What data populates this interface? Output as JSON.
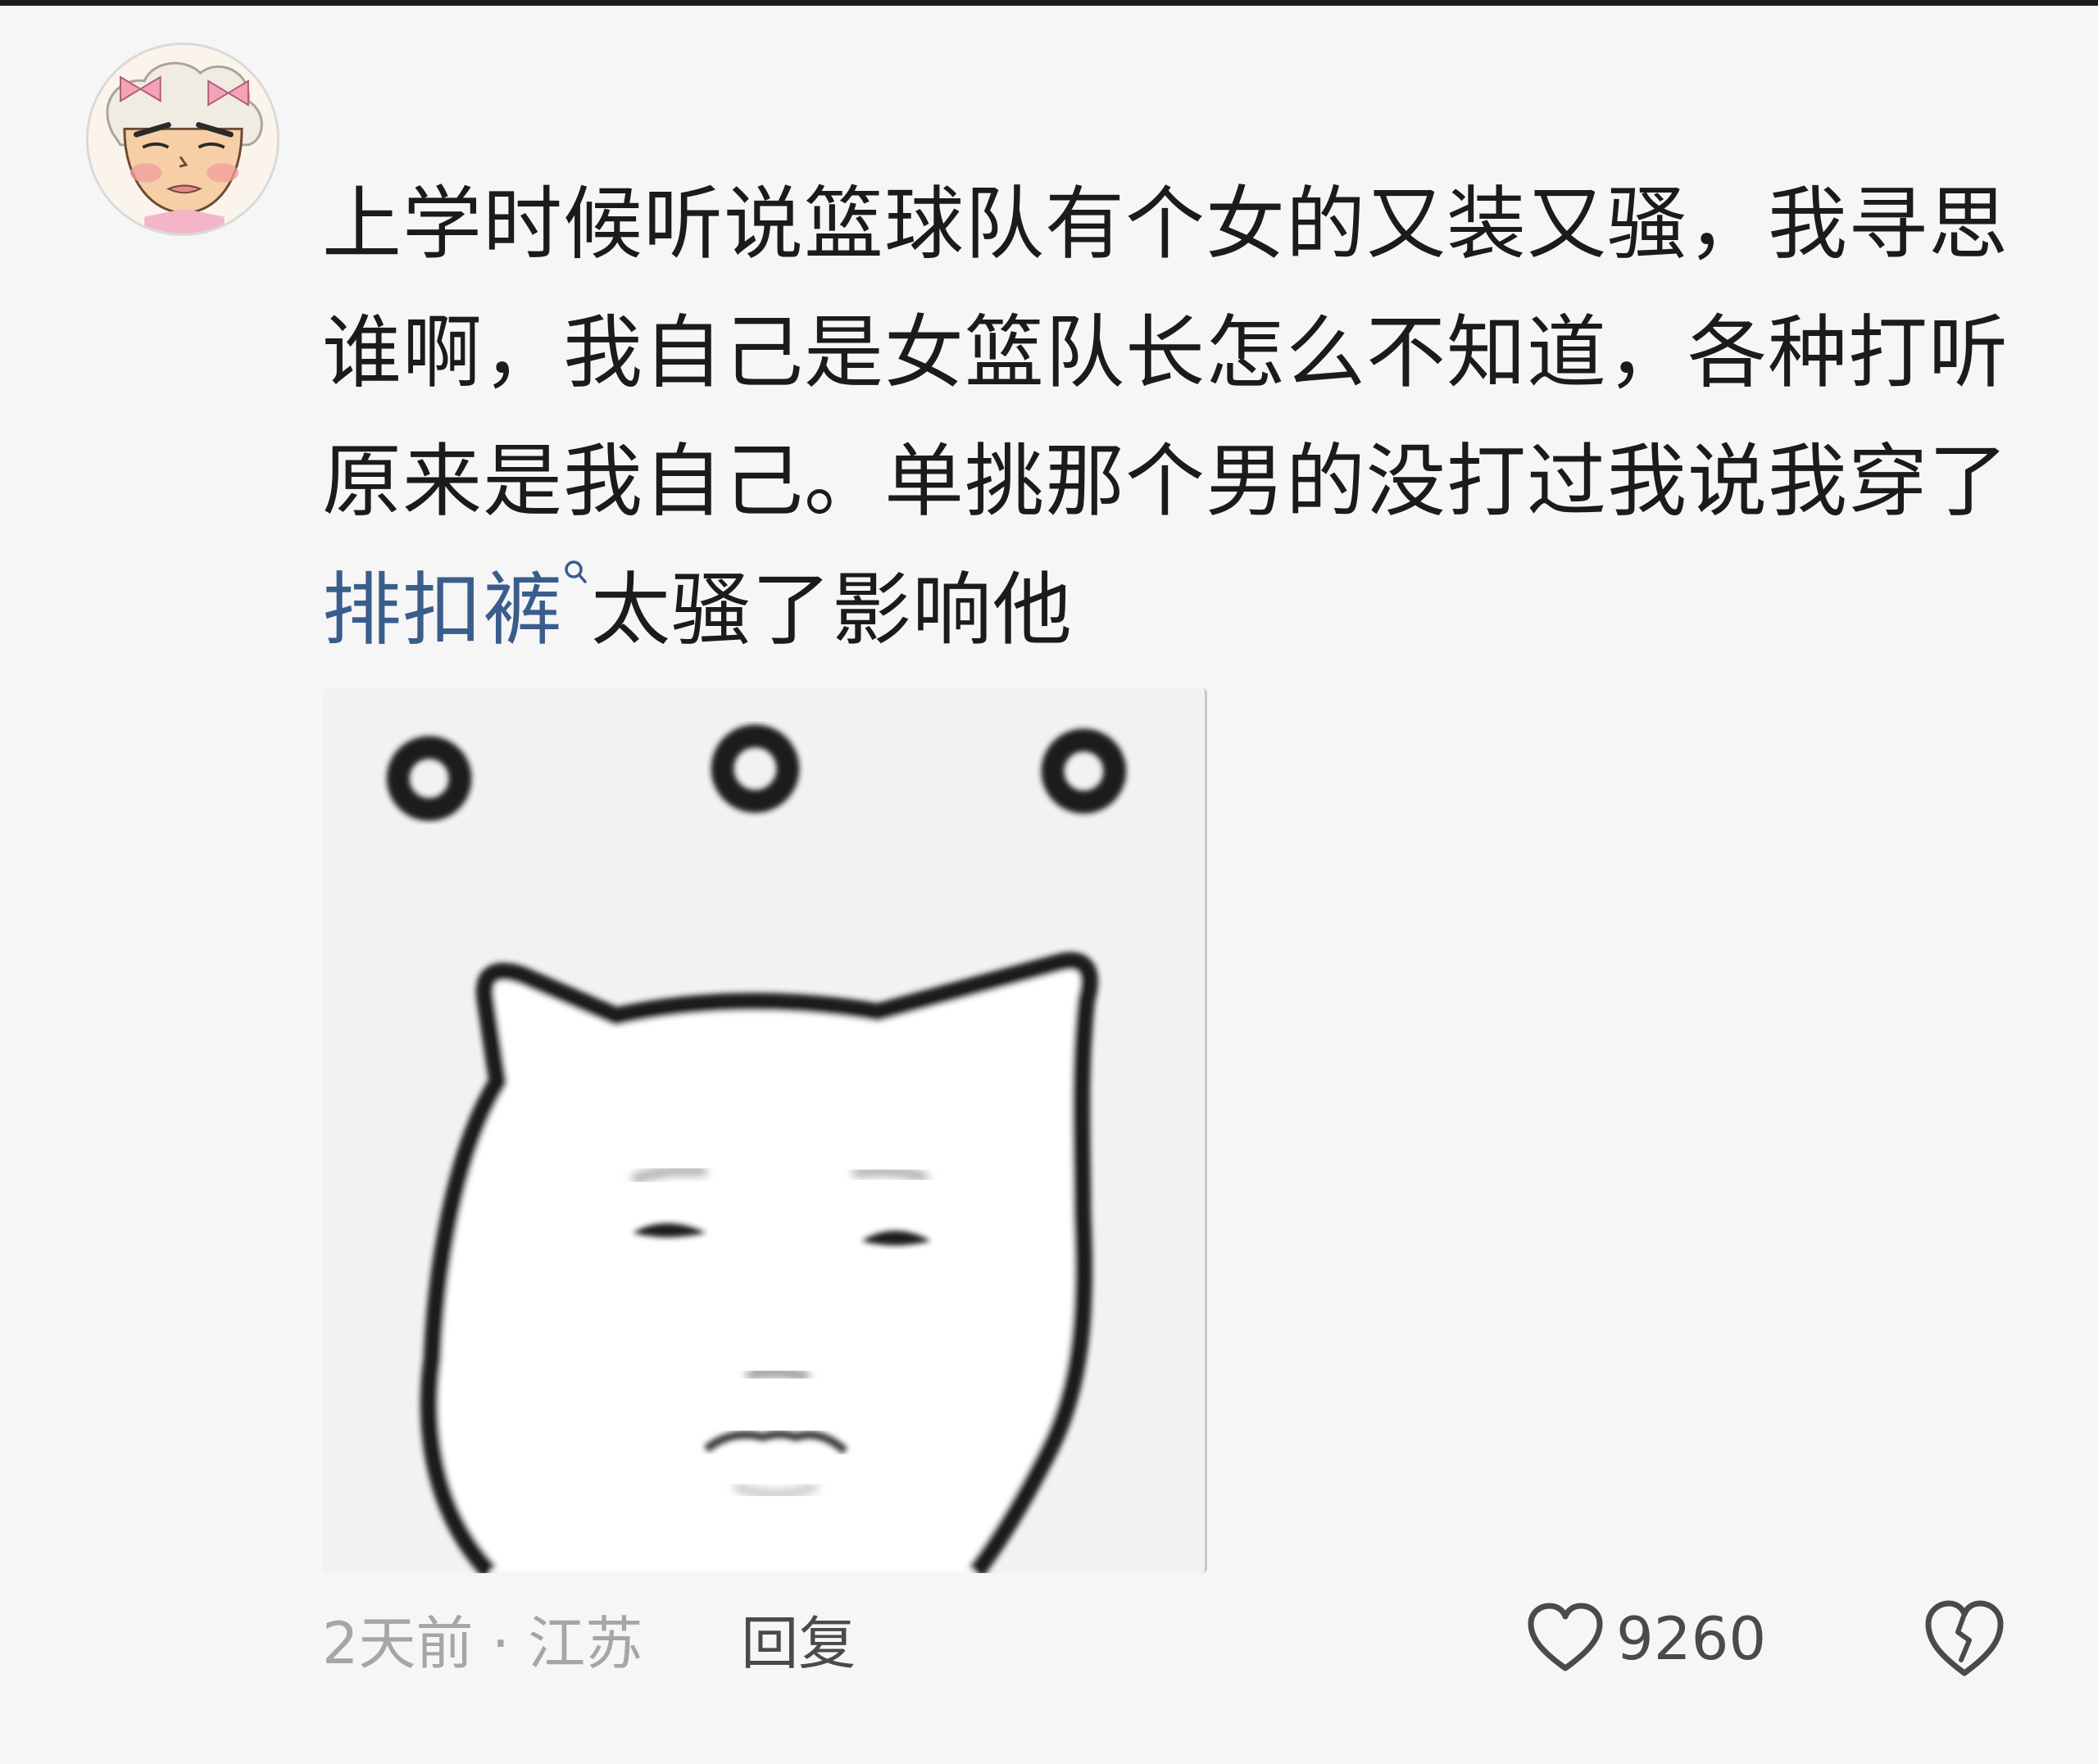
{
  "comment": {
    "lines": [
      "上学时候听说篮球队有个女的又装又骚，我寻思",
      "谁啊，我自己是女篮队长怎么不知道，各种打听",
      "原来是我自己。单挑那个男的没打过我说我穿了"
    ],
    "link_text": "排扣裤",
    "tail_text": "太骚了影响他"
  },
  "meta": {
    "time_location": "2天前 · 江苏",
    "reply_label": "回复"
  },
  "actions": {
    "like_count": "9260"
  },
  "colors": {
    "background": "#f6f6f6",
    "text": "#1b1b1b",
    "link": "#3a5d8c",
    "meta": "#a6a6a6"
  },
  "icons": {
    "avatar": "cartoon-avatar",
    "link": "search-icon",
    "like": "heart-icon",
    "dislike": "broken-heart-icon"
  }
}
